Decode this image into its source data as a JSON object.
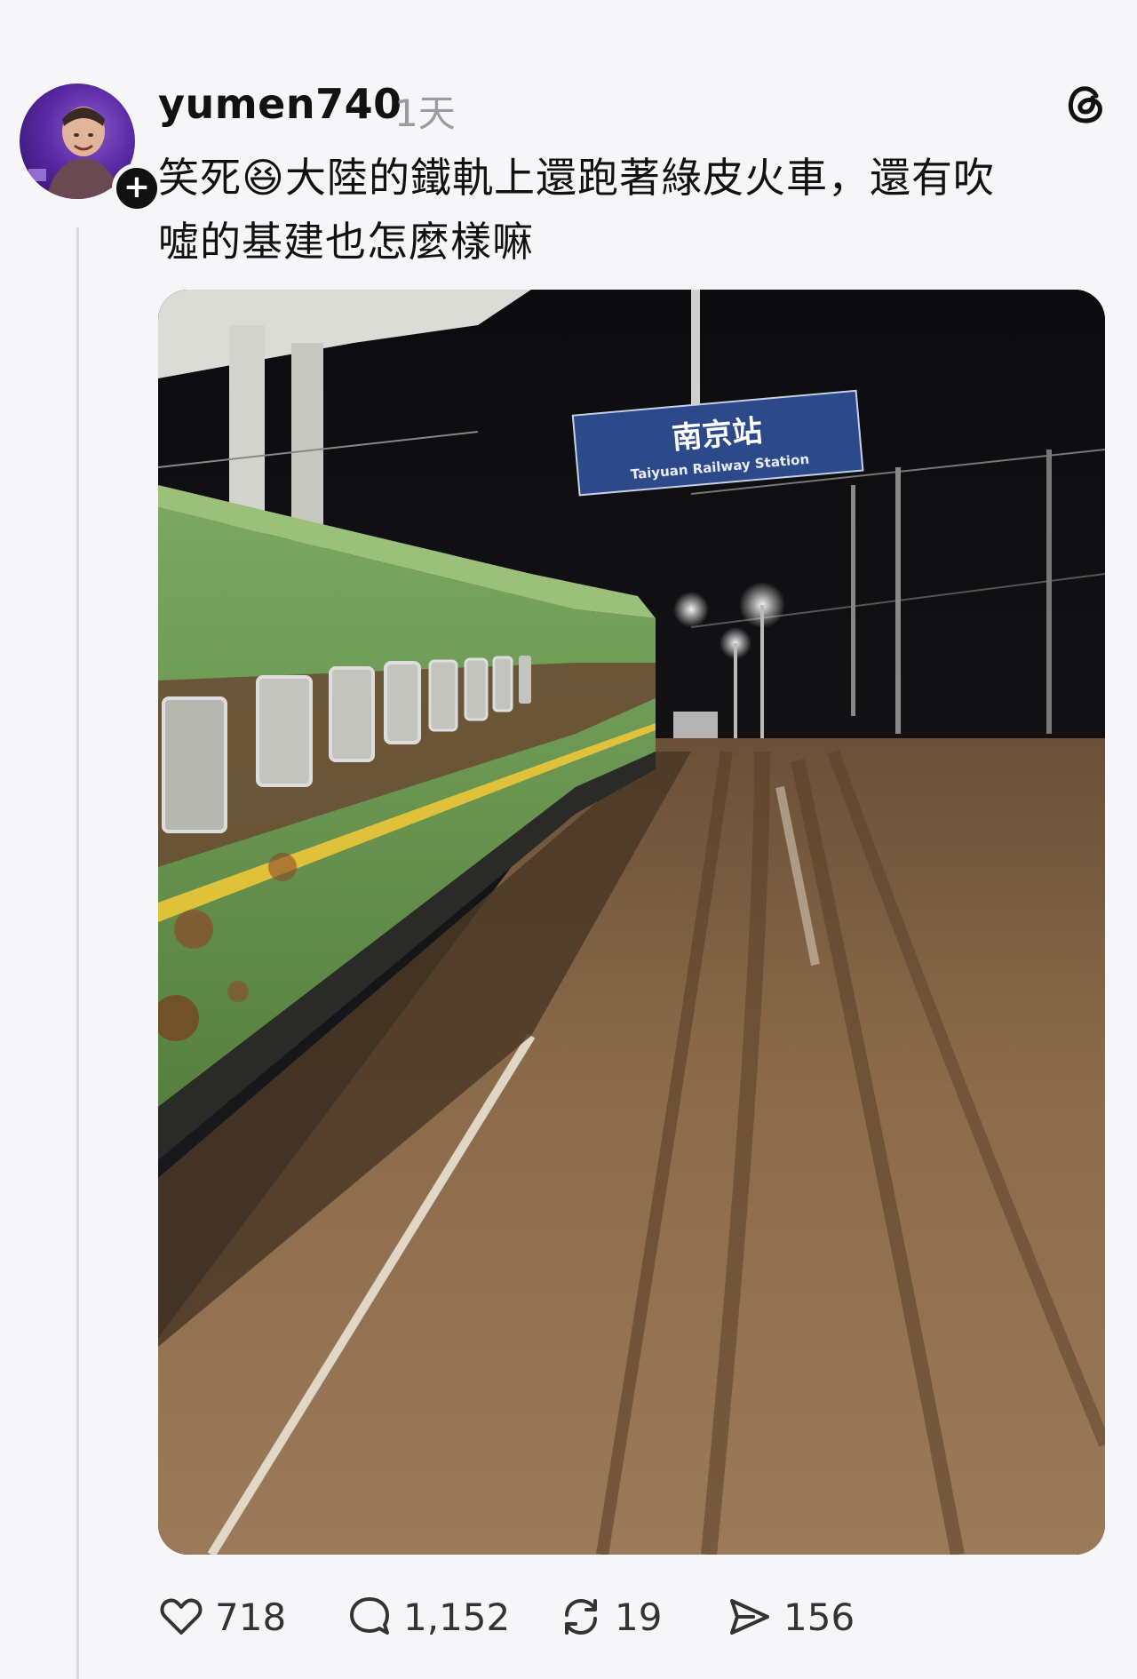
{
  "post": {
    "username": "yumen740",
    "timestamp": "1天",
    "caption_line1": "笑死😆大陸的鐵軌上還跑著綠皮火車，還有吹",
    "caption_line2": "噓的基建也怎麼樣嘛",
    "follow_symbol": "+",
    "media": {
      "sign_title": "南京站",
      "sign_subtitle": "Taiyuan Railway Station"
    }
  },
  "actions": {
    "likes": "718",
    "replies": "1,152",
    "reposts": "19",
    "shares": "156"
  },
  "colors": {
    "background": "#f6f6f8",
    "train_green": "#6b9a52",
    "sign_blue": "#2c4a8a",
    "mud": "#8a6a48"
  },
  "icons": [
    "threads-logo-icon",
    "heart-icon",
    "comment-icon",
    "repost-icon",
    "share-icon",
    "follow-plus-icon"
  ]
}
